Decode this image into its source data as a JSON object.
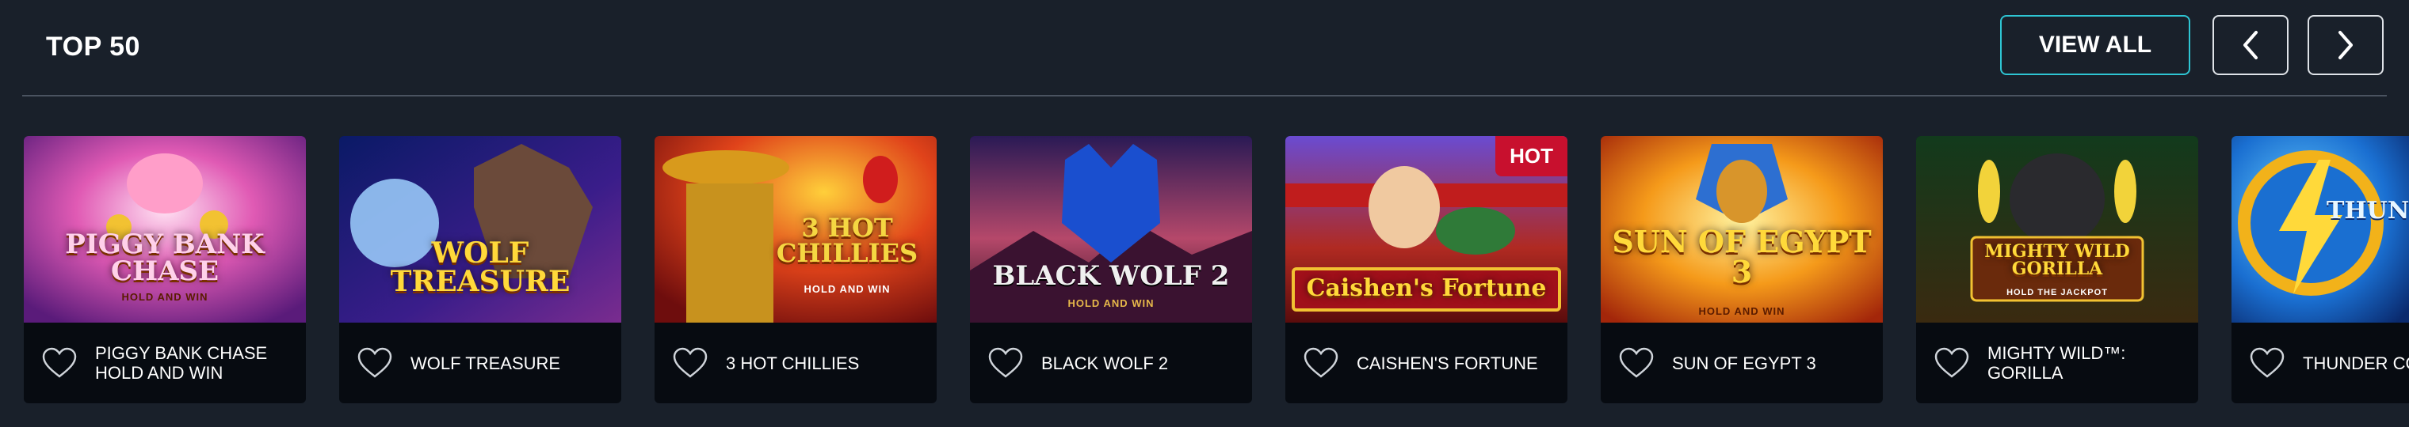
{
  "section": {
    "title": "TOP 50",
    "view_all_label": "VIEW ALL",
    "prev_icon": "chevron-left-icon",
    "next_icon": "chevron-right-icon",
    "accent_color": "#2ec5d3",
    "background_color": "#19202a"
  },
  "games": [
    {
      "name": "PIGGY BANK CHASE HOLD AND WIN",
      "thumb_title": "PIGGY BANK CHASE",
      "thumb_sub": "HOLD AND WIN",
      "badge": ""
    },
    {
      "name": "WOLF TREASURE",
      "thumb_title": "WOLF TREASURE",
      "thumb_sub": "",
      "badge": ""
    },
    {
      "name": "3 HOT CHILLIES",
      "thumb_title": "3 HOT CHILLIES",
      "thumb_sub": "HOLD AND WIN",
      "badge": ""
    },
    {
      "name": "BLACK WOLF 2",
      "thumb_title": "BLACK WOLF 2",
      "thumb_sub": "HOLD AND WIN",
      "badge": ""
    },
    {
      "name": "CAISHEN'S FORTUNE",
      "thumb_title": "Caishen's Fortune",
      "thumb_sub": "",
      "badge": "HOT"
    },
    {
      "name": "SUN OF EGYPT 3",
      "thumb_title": "SUN OF EGYPT 3",
      "thumb_sub": "HOLD AND WIN",
      "badge": ""
    },
    {
      "name": "MIGHTY WILD™: GORILLA",
      "thumb_title": "MIGHTY WILD GORILLA",
      "thumb_sub": "HOLD THE JACKPOT",
      "badge": ""
    },
    {
      "name": "THUNDER COINS HOLD AND WIN",
      "thumb_title": "THUNDER COINS",
      "thumb_sub": "",
      "badge": ""
    }
  ]
}
